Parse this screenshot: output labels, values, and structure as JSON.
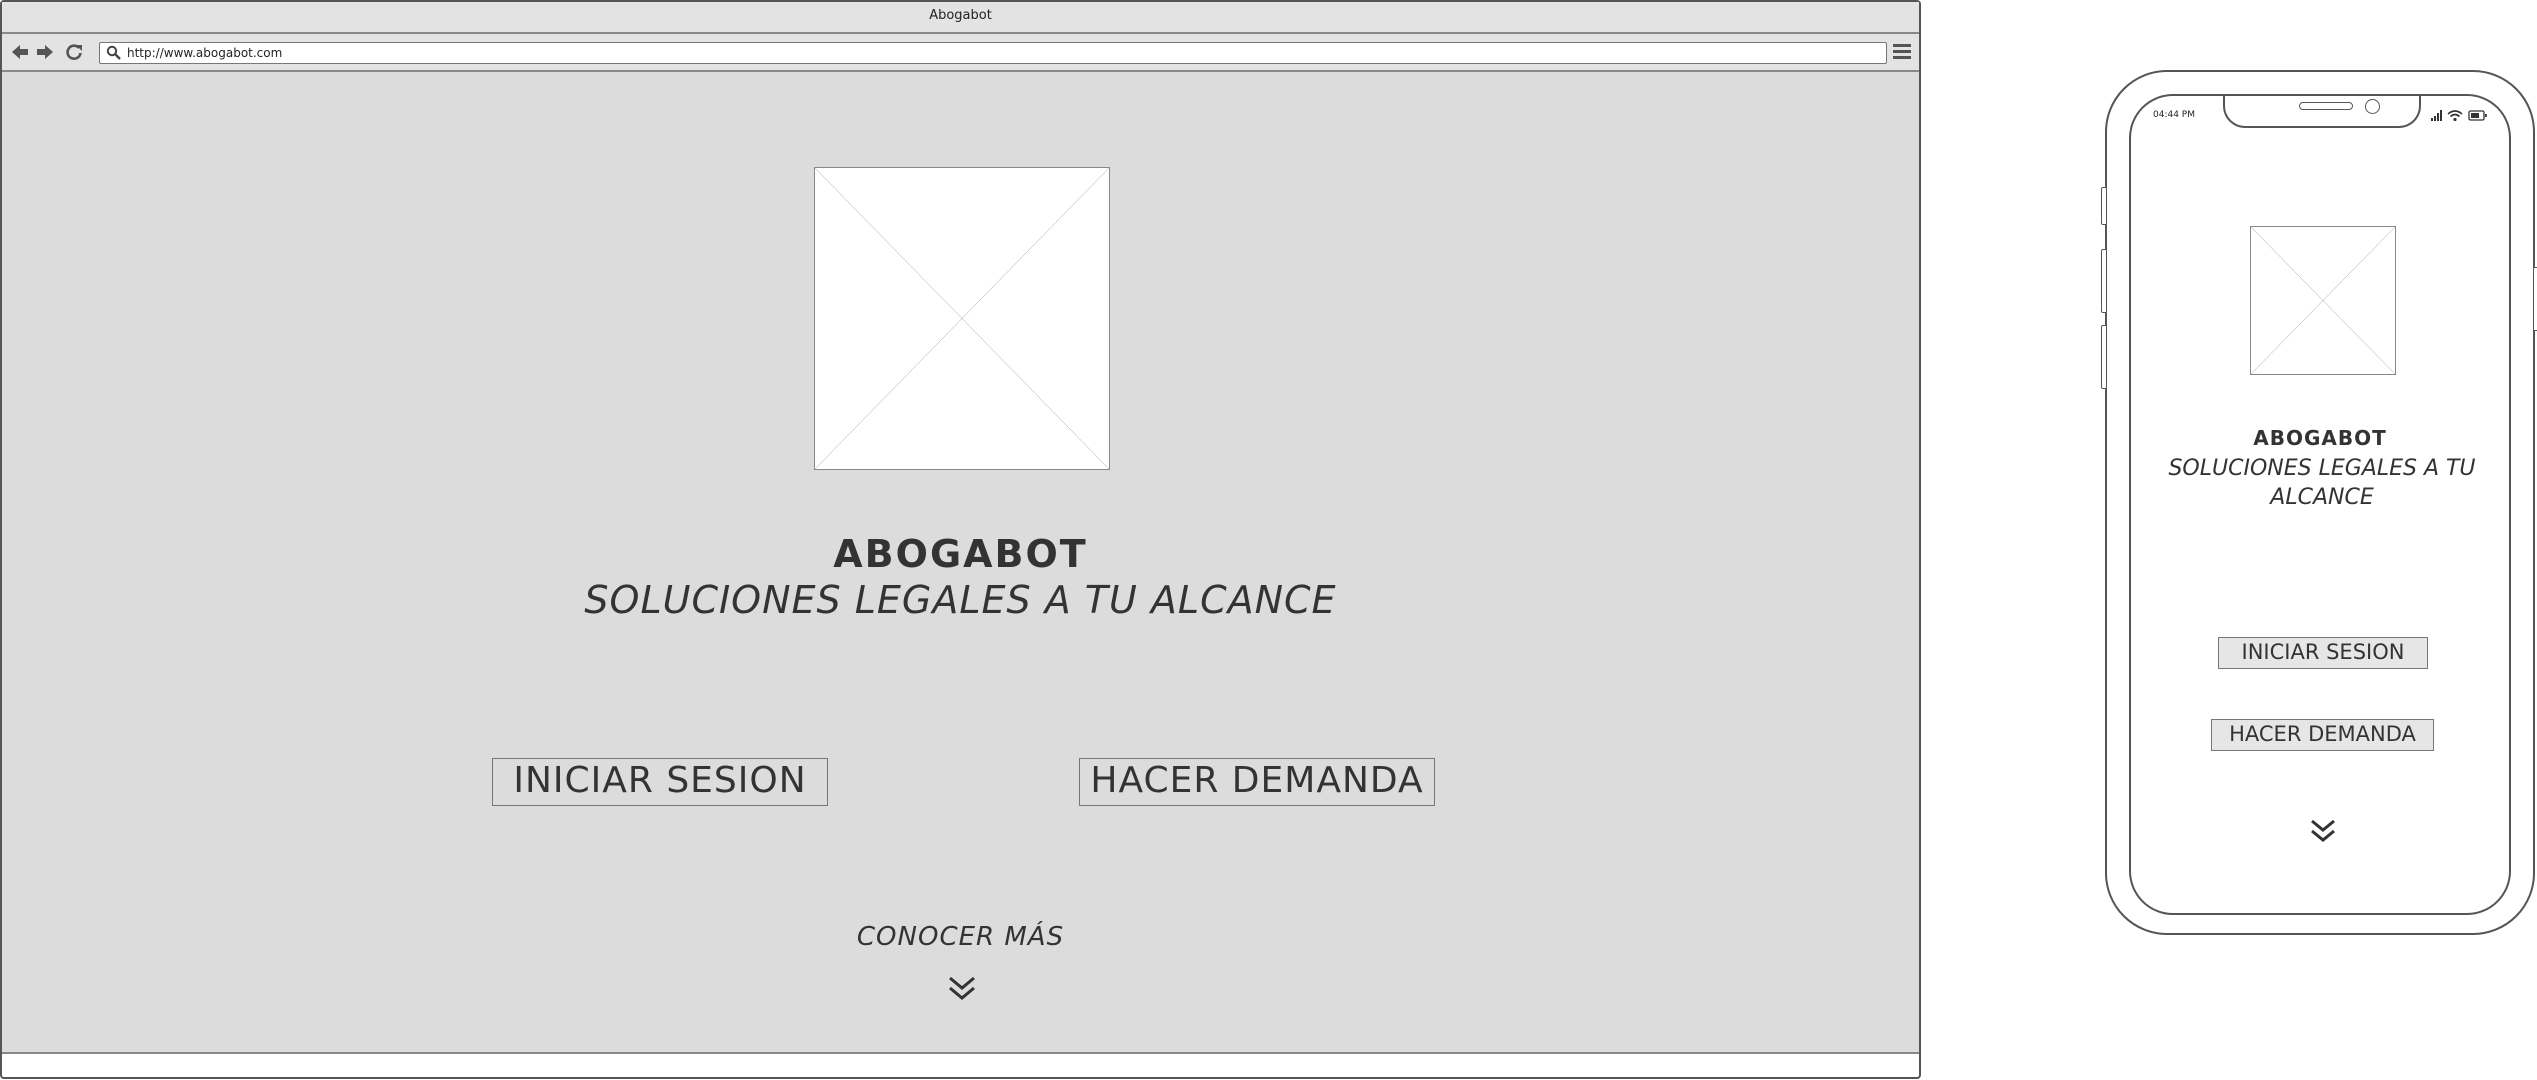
{
  "desktop": {
    "window_title": "Abogabot",
    "url": "http://www.abogabot.com",
    "brand_title": "ABOGABOT",
    "tagline": "SOLUCIONES LEGALES A TU ALCANCE",
    "login_button": "INICIAR SESION",
    "demand_button": "HACER DEMANDA",
    "more_label": "CONOCER MÁS",
    "icons": {
      "back": "arrow-left-icon",
      "forward": "arrow-right-icon",
      "reload": "reload-icon",
      "search": "search-icon",
      "menu": "hamburger-menu-icon",
      "scroll": "double-chevron-down-icon"
    }
  },
  "mobile": {
    "status_time": "04:44 PM",
    "brand_title": "ABOGABOT",
    "tagline": "SOLUCIONES LEGALES A TU ALCANCE",
    "login_button": "INICIAR SESION",
    "demand_button": "HACER DEMANDA",
    "icons": {
      "signal": "signal-bars-icon",
      "wifi": "wifi-icon",
      "battery": "battery-icon",
      "scroll": "double-chevron-down-icon"
    }
  },
  "colors": {
    "canvas_background": "#dcdcdc",
    "outline": "#555555",
    "text": "#333333"
  }
}
